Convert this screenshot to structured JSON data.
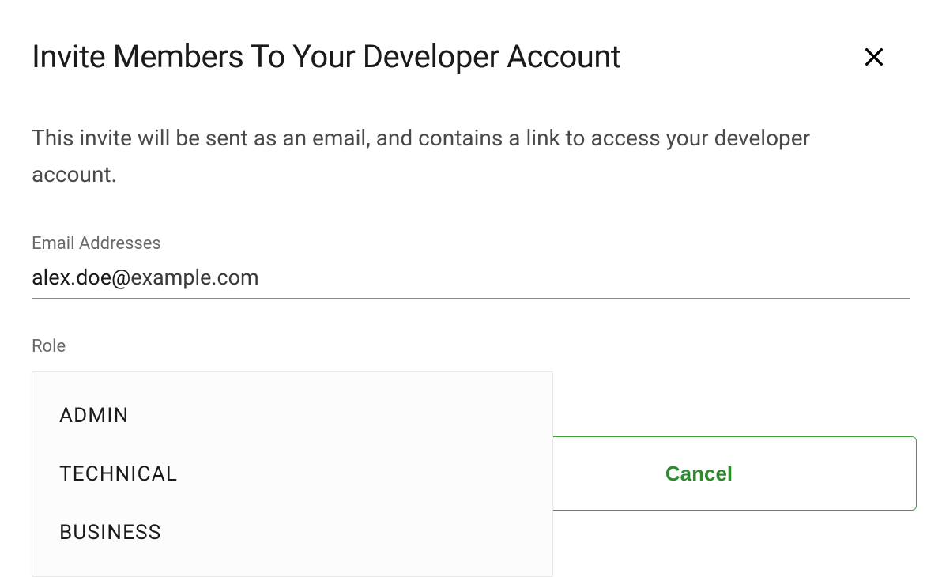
{
  "dialog": {
    "title": "Invite Members To Your Developer Account",
    "description": "This invite will be sent as an email, and contains a link to access your developer account."
  },
  "fields": {
    "email": {
      "label": "Email Addresses",
      "value_local": "alex.doe@",
      "value_domain": "example.com"
    },
    "role": {
      "label": "Role",
      "options": [
        "ADMIN",
        "TECHNICAL",
        "BUSINESS"
      ]
    }
  },
  "buttons": {
    "cancel": "Cancel"
  },
  "colors": {
    "accent": "#2e8b2e",
    "text_primary": "#1a1a1a",
    "text_muted": "#6a6a6a",
    "border": "#888888"
  }
}
